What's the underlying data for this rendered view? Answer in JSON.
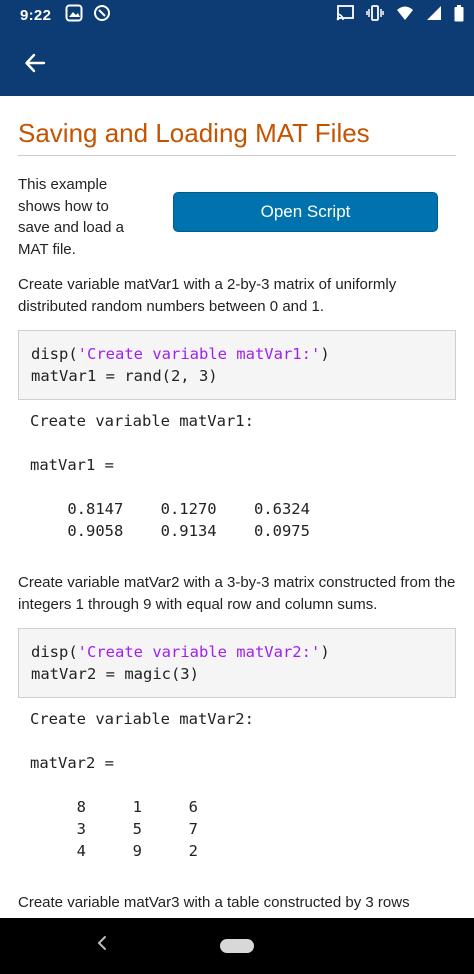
{
  "status": {
    "time": "9:22",
    "left_icons": [
      "photo-icon",
      "sync-icon"
    ],
    "right_icons": [
      "cast-icon",
      "vibrate-icon",
      "wifi-icon",
      "signal-icon",
      "battery-icon"
    ]
  },
  "appbar": {
    "back_icon": "arrow-left-icon"
  },
  "page": {
    "title": "Saving and Loading MAT Files",
    "intro": "This example shows how to save and load a MAT file.",
    "open_script_label": "Open Script",
    "para1": "Create variable matVar1 with a 2-by-3 matrix of uniformly distributed random numbers between 0 and 1.",
    "code1": {
      "l1_pre": "disp(",
      "l1_str": "'Create variable matVar1:'",
      "l1_post": ")",
      "l2": "matVar1 = rand(2, 3)"
    },
    "output1": "Create variable matVar1:\n\nmatVar1 =\n\n    0.8147    0.1270    0.6324\n    0.9058    0.9134    0.0975",
    "para2": "Create variable matVar2 with a 3-by-3 matrix constructed from the integers 1 through 9 with equal row and column sums.",
    "code2": {
      "l1_pre": "disp(",
      "l1_str": "'Create variable matVar2:'",
      "l1_post": ")",
      "l2": "matVar2 = magic(3)"
    },
    "output2": "Create variable matVar2:\n\nmatVar2 =\n\n     8     1     6\n     3     5     7\n     4     9     2",
    "para3": "Create variable matVar3 with a table constructed by 3 rows"
  },
  "navbar": {
    "back_icon": "nav-back-icon",
    "home_icon": "nav-home-pill"
  },
  "colors": {
    "appbar": "#0c3c73",
    "title": "#c45400",
    "button": "#0073ae",
    "string": "#a020f0"
  }
}
